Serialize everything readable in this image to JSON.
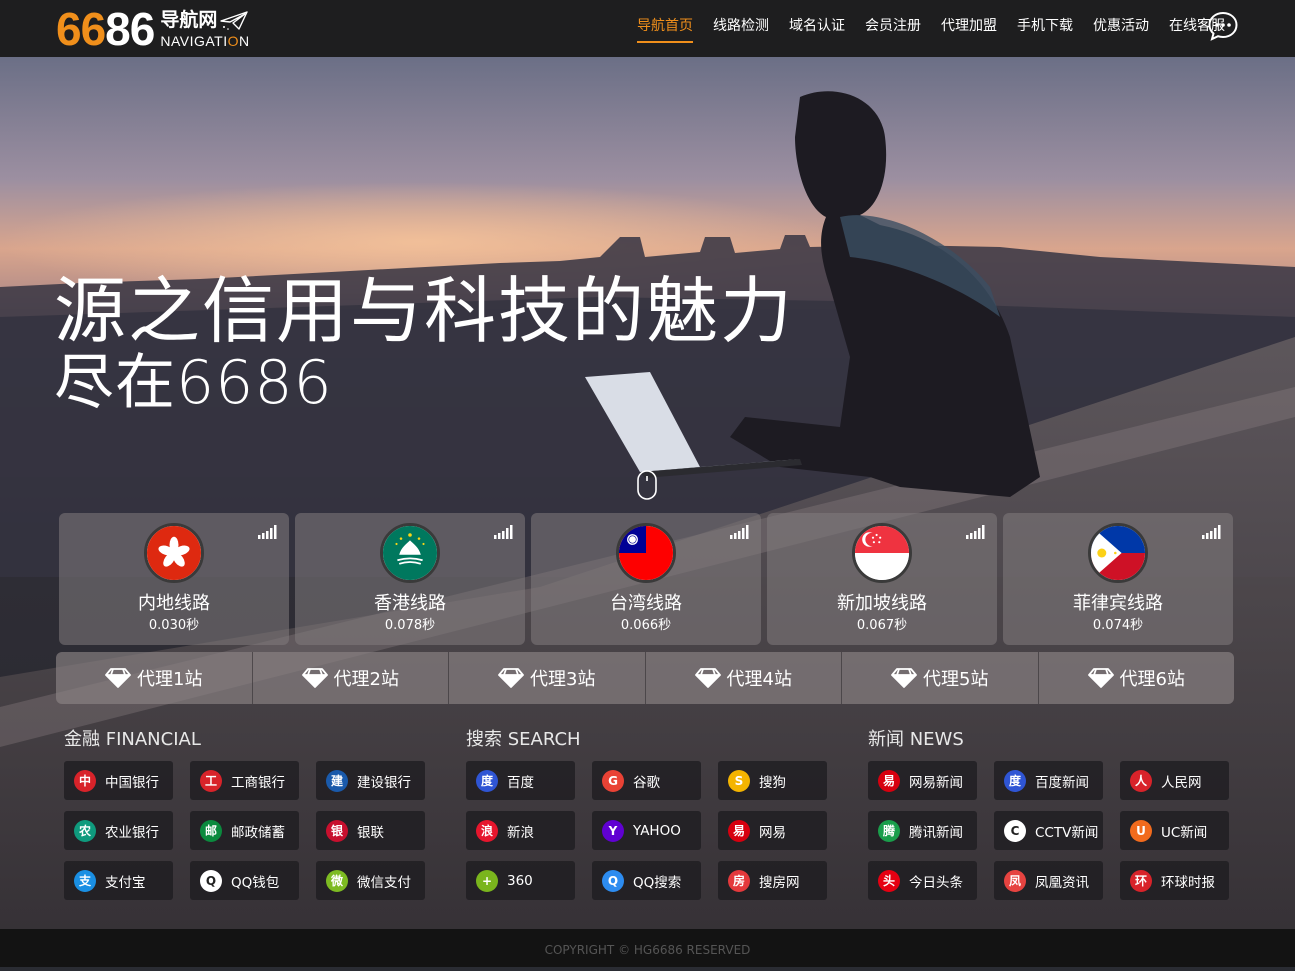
{
  "logo": {
    "number_orange": "66",
    "number_white": "86",
    "cn": "导航网",
    "en_before": "NAVIGATI",
    "en_highlight": "O",
    "en_after": "N"
  },
  "nav": {
    "items": [
      {
        "label": "导航首页",
        "active": true
      },
      {
        "label": "线路检测"
      },
      {
        "label": "域名认证"
      },
      {
        "label": "会员注册"
      },
      {
        "label": "代理加盟"
      },
      {
        "label": "手机下载"
      },
      {
        "label": "优惠活动"
      },
      {
        "label": "在线客服"
      }
    ],
    "chat_icon": "chat-bubble-icon"
  },
  "hero": {
    "headline1": "源之信用与科技的魅力",
    "headline2": "尽在6686",
    "scroll_icon": "mouse-icon"
  },
  "routes": [
    {
      "name": "内地线路",
      "speed": "0.030秒",
      "flag": "hong-kong-flag-icon"
    },
    {
      "name": "香港线路",
      "speed": "0.078秒",
      "flag": "macau-flag-icon"
    },
    {
      "name": "台湾线路",
      "speed": "0.066秒",
      "flag": "taiwan-flag-icon"
    },
    {
      "name": "新加坡线路",
      "speed": "0.067秒",
      "flag": "singapore-flag-icon"
    },
    {
      "name": "菲律宾线路",
      "speed": "0.074秒",
      "flag": "philippines-flag-icon"
    }
  ],
  "agents": [
    "代理1站",
    "代理2站",
    "代理3站",
    "代理4站",
    "代理5站",
    "代理6站"
  ],
  "groups": {
    "financial": {
      "title": "金融 FINANCIAL",
      "links": [
        {
          "label": "中国银行",
          "icon": "bank-of-china-icon",
          "color": "#d8232a",
          "glyph": "中"
        },
        {
          "label": "工商银行",
          "icon": "icbc-icon",
          "color": "#d8232a",
          "glyph": "工"
        },
        {
          "label": "建设银行",
          "icon": "ccb-icon",
          "color": "#1a5aab",
          "glyph": "建"
        },
        {
          "label": "农业银行",
          "icon": "abc-icon",
          "color": "#0f9a7d",
          "glyph": "农"
        },
        {
          "label": "邮政储蓄",
          "icon": "postal-savings-icon",
          "color": "#0b8a3e",
          "glyph": "邮"
        },
        {
          "label": "银联",
          "icon": "unionpay-icon",
          "color": "#c8102e",
          "glyph": "银"
        },
        {
          "label": "支付宝",
          "icon": "alipay-icon",
          "color": "#1a8fe3",
          "glyph": "支"
        },
        {
          "label": "QQ钱包",
          "icon": "qq-wallet-icon",
          "color": "#ffffff",
          "glyph": "Q"
        },
        {
          "label": "微信支付",
          "icon": "wechat-pay-icon",
          "color": "#7dbb22",
          "glyph": "微"
        }
      ]
    },
    "search": {
      "title": "搜索 SEARCH",
      "links": [
        {
          "label": "百度",
          "icon": "baidu-icon",
          "color": "#2f55d4",
          "glyph": "度"
        },
        {
          "label": "谷歌",
          "icon": "google-icon",
          "color": "#e94235",
          "glyph": "G"
        },
        {
          "label": "搜狗",
          "icon": "sogou-icon",
          "color": "#f4b400",
          "glyph": "S"
        },
        {
          "label": "新浪",
          "icon": "sina-icon",
          "color": "#e6162d",
          "glyph": "浪"
        },
        {
          "label": "YAHOO",
          "icon": "yahoo-icon",
          "color": "#6001d2",
          "glyph": "Y"
        },
        {
          "label": "网易",
          "icon": "netease-icon",
          "color": "#d7000f",
          "glyph": "易"
        },
        {
          "label": "360",
          "icon": "360-icon",
          "color": "#7ab51d",
          "glyph": "+"
        },
        {
          "label": "QQ搜索",
          "icon": "qq-search-icon",
          "color": "#2d8cf0",
          "glyph": "Q"
        },
        {
          "label": "搜房网",
          "icon": "soufun-icon",
          "color": "#e4393c",
          "glyph": "房"
        }
      ]
    },
    "news": {
      "title": "新闻 NEWS",
      "links": [
        {
          "label": "网易新闻",
          "icon": "netease-news-icon",
          "color": "#d7000f",
          "glyph": "易"
        },
        {
          "label": "百度新闻",
          "icon": "baidu-news-icon",
          "color": "#2f55d4",
          "glyph": "度"
        },
        {
          "label": "人民网",
          "icon": "people-daily-icon",
          "color": "#d8232a",
          "glyph": "人"
        },
        {
          "label": "腾讯新闻",
          "icon": "tencent-news-icon",
          "color": "#1a9e4b",
          "glyph": "腾"
        },
        {
          "label": "CCTV新闻",
          "icon": "cctv-icon",
          "color": "#ffffff",
          "glyph": "C"
        },
        {
          "label": "UC新闻",
          "icon": "uc-news-icon",
          "color": "#f26b1d",
          "glyph": "U"
        },
        {
          "label": "今日头条",
          "icon": "toutiao-icon",
          "color": "#e60012",
          "glyph": "头"
        },
        {
          "label": "凤凰资讯",
          "icon": "ifeng-icon",
          "color": "#e64340",
          "glyph": "凤"
        },
        {
          "label": "环球时报",
          "icon": "global-times-icon",
          "color": "#d8232a",
          "glyph": "环"
        }
      ]
    }
  },
  "footer": {
    "copyright": "COPYRIGHT © HG6686 RESERVED"
  }
}
